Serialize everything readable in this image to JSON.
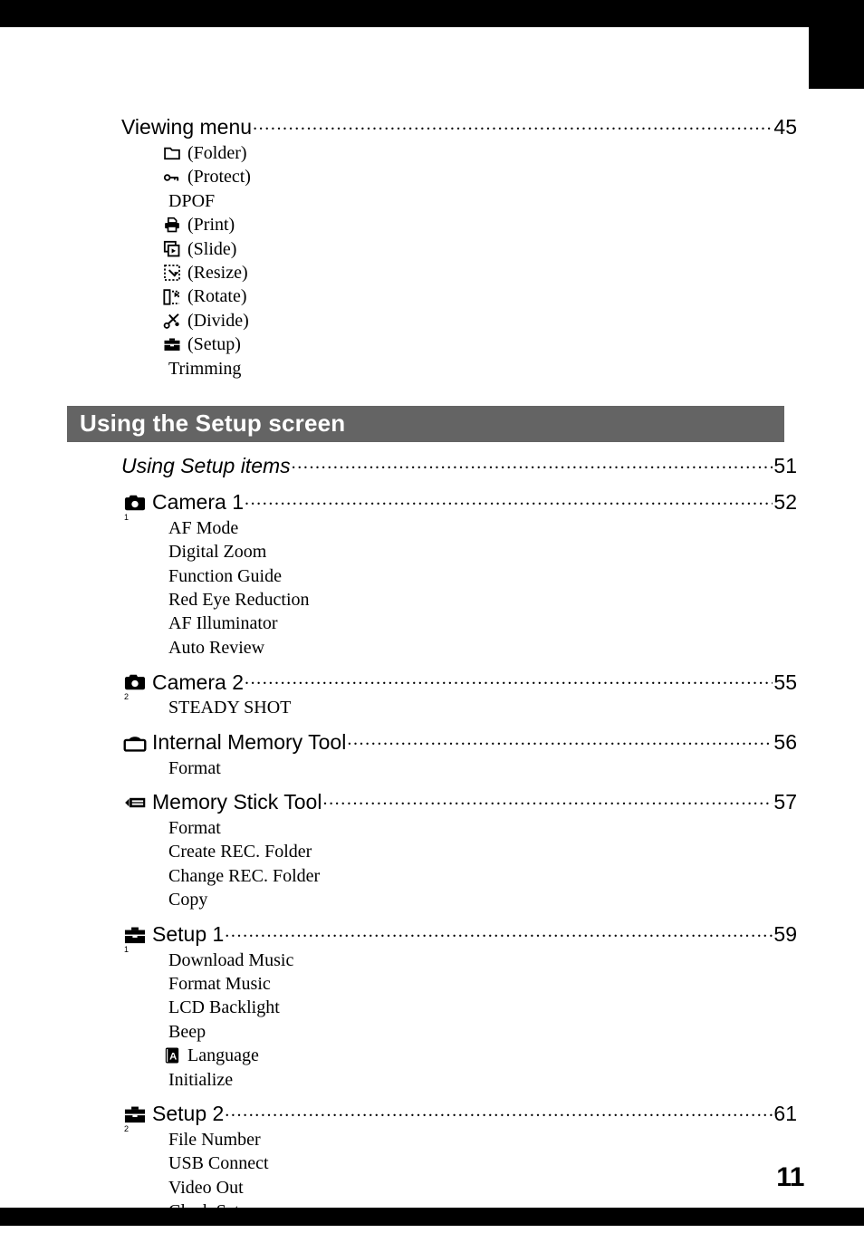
{
  "page": {
    "number": "11",
    "accent_gray": "#646464",
    "ink": "#000000"
  },
  "viewing_menu": {
    "title": "Viewing menu",
    "page": "45",
    "items": [
      {
        "icon": "folder-icon",
        "label": "(Folder)"
      },
      {
        "icon": "key-icon",
        "label": "(Protect)"
      },
      {
        "icon": "none",
        "label": "DPOF"
      },
      {
        "icon": "printer-icon",
        "label": "(Print)"
      },
      {
        "icon": "slide-icon",
        "label": "(Slide)"
      },
      {
        "icon": "resize-icon",
        "label": "(Resize)"
      },
      {
        "icon": "rotate-icon",
        "label": "(Rotate)"
      },
      {
        "icon": "scissors-icon",
        "label": "(Divide)"
      },
      {
        "icon": "toolbox-icon",
        "label": "(Setup)"
      },
      {
        "icon": "none",
        "label": "Trimming"
      }
    ]
  },
  "setup_section": {
    "banner_title": "Using the Setup screen",
    "entries": [
      {
        "title": "Using Setup items",
        "page": "51",
        "style": "italic",
        "icon": "none",
        "icon_sub": "",
        "items": []
      },
      {
        "title": "Camera 1",
        "page": "52",
        "style": "normal",
        "icon": "camera-icon",
        "icon_sub": "1",
        "items": [
          "AF Mode",
          "Digital Zoom",
          "Function Guide",
          "Red Eye Reduction",
          "AF Illuminator",
          "Auto Review"
        ]
      },
      {
        "title": "Camera 2",
        "page": "55",
        "style": "normal",
        "icon": "camera-icon",
        "icon_sub": "2",
        "items": [
          "STEADY SHOT"
        ]
      },
      {
        "title": "Internal Memory Tool",
        "page": "56",
        "style": "normal",
        "icon": "internal-memory-icon",
        "icon_sub": "",
        "items": [
          "Format"
        ]
      },
      {
        "title": "Memory Stick Tool",
        "page": "57",
        "style": "normal",
        "icon": "memory-stick-icon",
        "icon_sub": "",
        "items": [
          "Format",
          "Create REC. Folder",
          "Change REC. Folder",
          "Copy"
        ]
      },
      {
        "title": "Setup 1",
        "page": "59",
        "style": "normal",
        "icon": "toolbox-icon",
        "icon_sub": "1",
        "items": [
          "Download Music",
          "Format Music",
          "LCD Backlight",
          "Beep",
          {
            "icon": "language-a-icon",
            "label": "Language"
          },
          "Initialize"
        ]
      },
      {
        "title": "Setup 2",
        "page": "61",
        "style": "normal",
        "icon": "toolbox-icon",
        "icon_sub": "2",
        "items": [
          "File Number",
          "USB Connect",
          "Video Out",
          "Clock Set"
        ]
      }
    ]
  }
}
